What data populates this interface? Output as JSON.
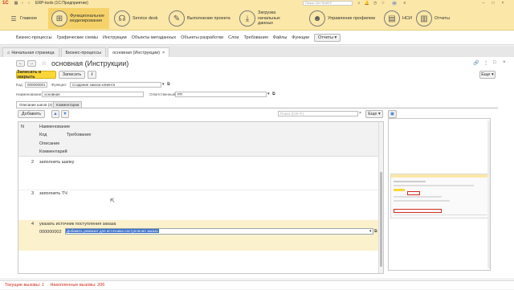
{
  "window": {
    "brand": "1С",
    "title": "ERP-tools (1С:Предприятие)",
    "search_placeholder": "Поиск Ctrl+Shift+F",
    "user_initials": "ГЗ"
  },
  "sections": [
    {
      "label": "Главное",
      "icon": "menu-icon"
    },
    {
      "label": "Функциональное моделирование",
      "icon": "structure-icon"
    },
    {
      "label": "Service desk",
      "icon": "headset-icon"
    },
    {
      "label": "Выполнение проекта",
      "icon": "wrench-icon"
    },
    {
      "label": "Загрузка начальных данных",
      "icon": "download-icon"
    },
    {
      "label": "Управление профилем",
      "icon": "users-icon"
    },
    {
      "label": "НСИ",
      "icon": "book-icon"
    },
    {
      "label": "Отчеты",
      "icon": "chart-icon"
    }
  ],
  "subnav": {
    "items": [
      "Бизнес-процессы",
      "Графические схемы",
      "Инструкции",
      "Объекты метаданных",
      "Объекты разработки",
      "Слои",
      "Требования",
      "Файлы",
      "Функции"
    ],
    "more": "Отчеты"
  },
  "tabs": [
    {
      "label": "Начальная страница"
    },
    {
      "label": "Бизнес-процессы"
    },
    {
      "label": "основная (Инструкции)"
    }
  ],
  "form": {
    "title": "основная (Инструкции)",
    "save_close": "Записать и закрыть",
    "save": "Записать",
    "more": "Еще",
    "code_label": "Код:",
    "code_value": "000000001",
    "function_label": "Функция:",
    "function_value": "Создание заказа клиента",
    "name_label": "Наименование:",
    "name_value": "основная",
    "responsible_label": "Ответственный:",
    "responsible_value": "РП"
  },
  "inner_tabs": [
    "Описание шагов (4)",
    "Комментарии"
  ],
  "grid_toolbar": {
    "add": "Добавить",
    "search_placeholder": "Поиск (Ctrl+F)",
    "more": "Еще"
  },
  "grid": {
    "headers": {
      "n": "N",
      "name": "Наименование",
      "code": "Код",
      "req": "Требование",
      "desc": "Описание",
      "comment": "Комментарий"
    },
    "rows": [
      {
        "n": "2",
        "text": "заполнить шапку"
      },
      {
        "n": "3",
        "text": "заполнить ТЧ"
      },
      {
        "n": "4",
        "text": "указать источник поступления заказа",
        "code": "000000002",
        "req": "Добавить реквизит для источника поступления заказа"
      }
    ]
  },
  "status": {
    "current_calls": "Текущие вызовы: 1",
    "accumulated_calls": "Накопленные вызовы: 206"
  }
}
